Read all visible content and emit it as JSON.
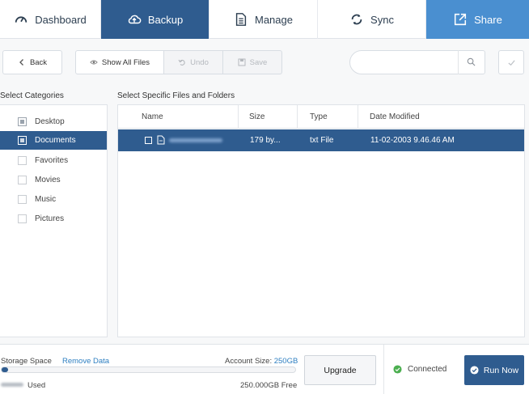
{
  "nav": {
    "tabs": [
      {
        "label": "Dashboard",
        "icon": "gauge-icon"
      },
      {
        "label": "Backup",
        "icon": "cloud-upload-icon"
      },
      {
        "label": "Manage",
        "icon": "document-icon"
      },
      {
        "label": "Sync",
        "icon": "sync-icon"
      },
      {
        "label": "Share",
        "icon": "share-icon"
      }
    ],
    "active": "Backup"
  },
  "toolbar": {
    "back_label": "Back",
    "show_all_label": "Show All Files",
    "undo_label": "Undo",
    "save_label": "Save",
    "search_value": ""
  },
  "categories": {
    "title": "Select Categories",
    "items": [
      {
        "label": "Desktop",
        "checked": "partial"
      },
      {
        "label": "Documents",
        "checked": "partial",
        "selected": true
      },
      {
        "label": "Favorites",
        "checked": "none"
      },
      {
        "label": "Movies",
        "checked": "none"
      },
      {
        "label": "Music",
        "checked": "none"
      },
      {
        "label": "Pictures",
        "checked": "none"
      }
    ]
  },
  "files": {
    "title": "Select Specific Files and Folders",
    "columns": [
      "Name",
      "Size",
      "Type",
      "Date Modified"
    ],
    "rows": [
      {
        "size": "179 by...",
        "type": "txt File",
        "date": "11-02-2003 9.46.46 AM",
        "selected": true
      }
    ]
  },
  "storage": {
    "label": "Storage Space",
    "remove_label": "Remove Data",
    "account_size_label": "Account Size:",
    "account_size_value": "250GB",
    "used_label": "Used",
    "free_label": "250.000GB Free",
    "used_fraction": 0.006
  },
  "actions": {
    "upgrade_label": "Upgrade",
    "status_label": "Connected",
    "run_now_label": "Run Now"
  },
  "colors": {
    "primary": "#2f5c8f",
    "accent": "#4a8fd0",
    "link": "#2e7fc1",
    "success": "#4caf50"
  }
}
